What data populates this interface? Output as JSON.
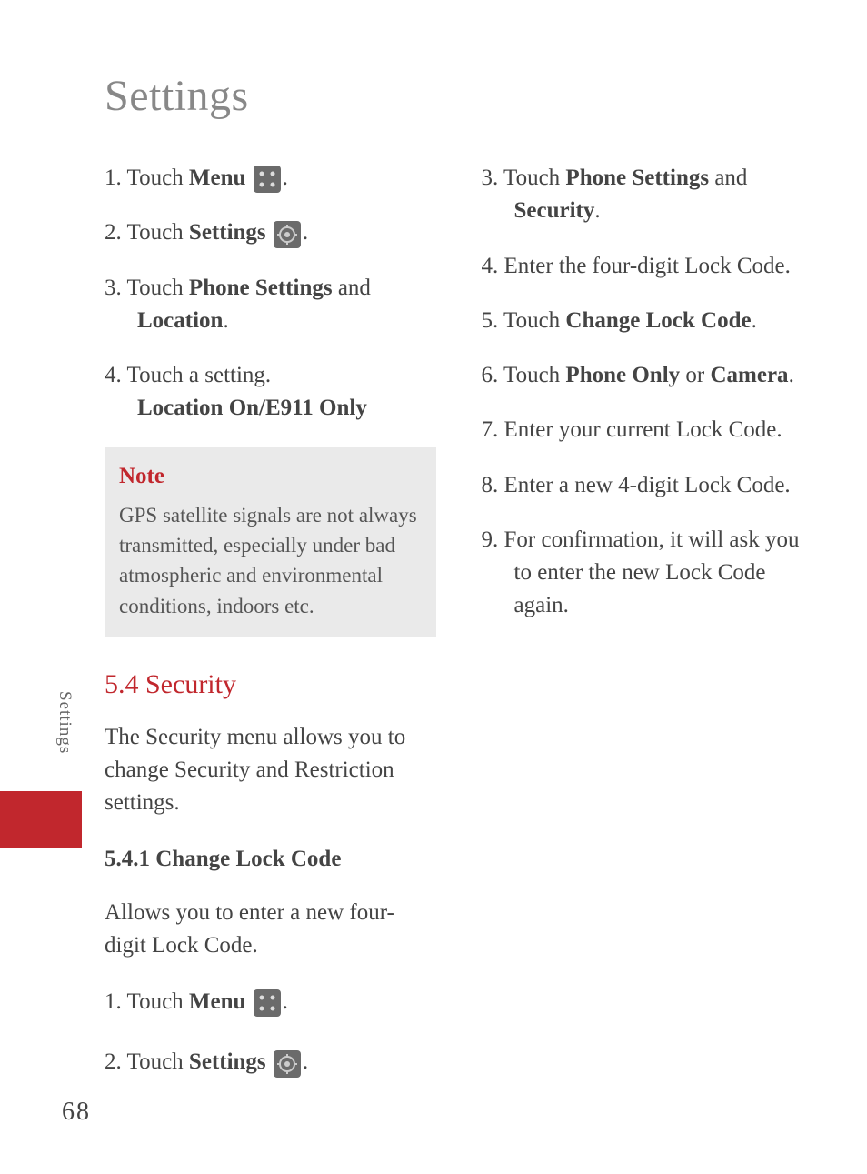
{
  "page_title": "Settings",
  "side_tab": "Settings",
  "page_number": "68",
  "left": {
    "steps_a": [
      {
        "num": "1.",
        "pre": " Touch ",
        "bold": "Menu",
        "post": "",
        "icon": "menu",
        "after_icon": "."
      },
      {
        "num": "2.",
        "pre": " Touch ",
        "bold": "Settings",
        "post": "",
        "icon": "gear",
        "after_icon": "."
      },
      {
        "num": "3.",
        "pre": " Touch ",
        "bold": "Phone Settings",
        "post": " and ",
        "bold2": "Location",
        "post2": "."
      },
      {
        "num": "4.",
        "pre": " Touch a setting.",
        "break": true,
        "bold": "Location On/E911 Only"
      }
    ],
    "note_title": "Note",
    "note_body": "GPS satellite signals are not always transmitted, especially under bad atmospheric and environmental conditions, indoors etc.",
    "section_heading": "5.4 Security",
    "section_body": "The Security menu allows you to change Security and Restriction settings.",
    "sub_heading": "5.4.1 Change Lock Code",
    "sub_body": "Allows you to enter a new four-digit Lock Code.",
    "steps_b": [
      {
        "num": "1.",
        "pre": " Touch ",
        "bold": "Menu",
        "post": "",
        "icon": "menu",
        "after_icon": "."
      }
    ]
  },
  "right": {
    "steps": [
      {
        "num": "2.",
        "pre": " Touch ",
        "bold": "Settings",
        "post": "",
        "icon": "gear",
        "after_icon": "."
      },
      {
        "num": "3.",
        "pre": " Touch ",
        "bold": "Phone Settings",
        "post": " and ",
        "bold2": "Security",
        "post2": "."
      },
      {
        "num": "4.",
        "pre": " Enter the four-digit Lock Code."
      },
      {
        "num": "5.",
        "pre": " Touch ",
        "bold": "Change Lock Code",
        "post": "."
      },
      {
        "num": "6.",
        "pre": " Touch ",
        "bold": "Phone Only",
        "post": " or ",
        "bold2": "Camera",
        "post2": "."
      },
      {
        "num": "7.",
        "pre": " Enter your current Lock Code."
      },
      {
        "num": "8.",
        "pre": " Enter a new 4-digit Lock Code."
      },
      {
        "num": "9.",
        "pre": " For confirmation, it will ask you to enter the new Lock Code again."
      }
    ]
  }
}
